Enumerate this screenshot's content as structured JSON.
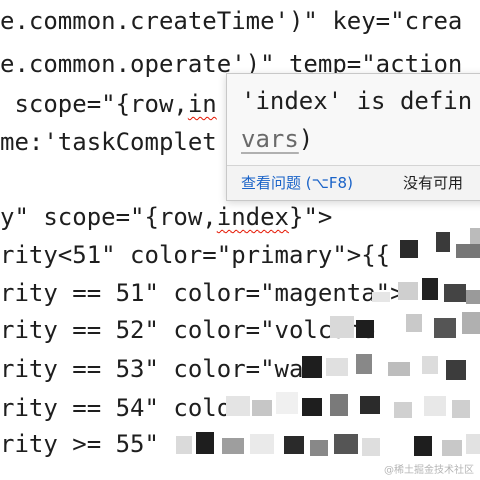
{
  "code": {
    "line1": "e.common.createTime')\" key=\"crea",
    "line2": "e.common.operate')\" temp=\"action",
    "line3_pre": " scope=\"{row,",
    "line3_err": "in",
    "line4": "me:'taskComplet",
    "line6_pre": "y\" scope=\"{row,",
    "line6_err": "index",
    "line6_post": "}\">",
    "line7": "rity<51\" color=\"primary\">{{ ",
    "line8": "rity == 51\" color=\"magenta\">",
    "line9": "rity == 52\" color=\"volcano",
    "line10": "rity == 53\" color=\"wa",
    "line11": "rity == 54\" colo",
    "line12": "rity >= 55\" "
  },
  "hover": {
    "message_line1": "'index' is defin",
    "message_vars": "vars",
    "message_close": ")",
    "view_problem": "查看问题 (⌥F8)",
    "no_quick_fix": "没有可用"
  },
  "watermark": "@稀土掘金技术社区",
  "colors": {
    "squiggle": "#e51400",
    "link": "#1a63c8",
    "hover_bg": "#f8f8f8"
  }
}
